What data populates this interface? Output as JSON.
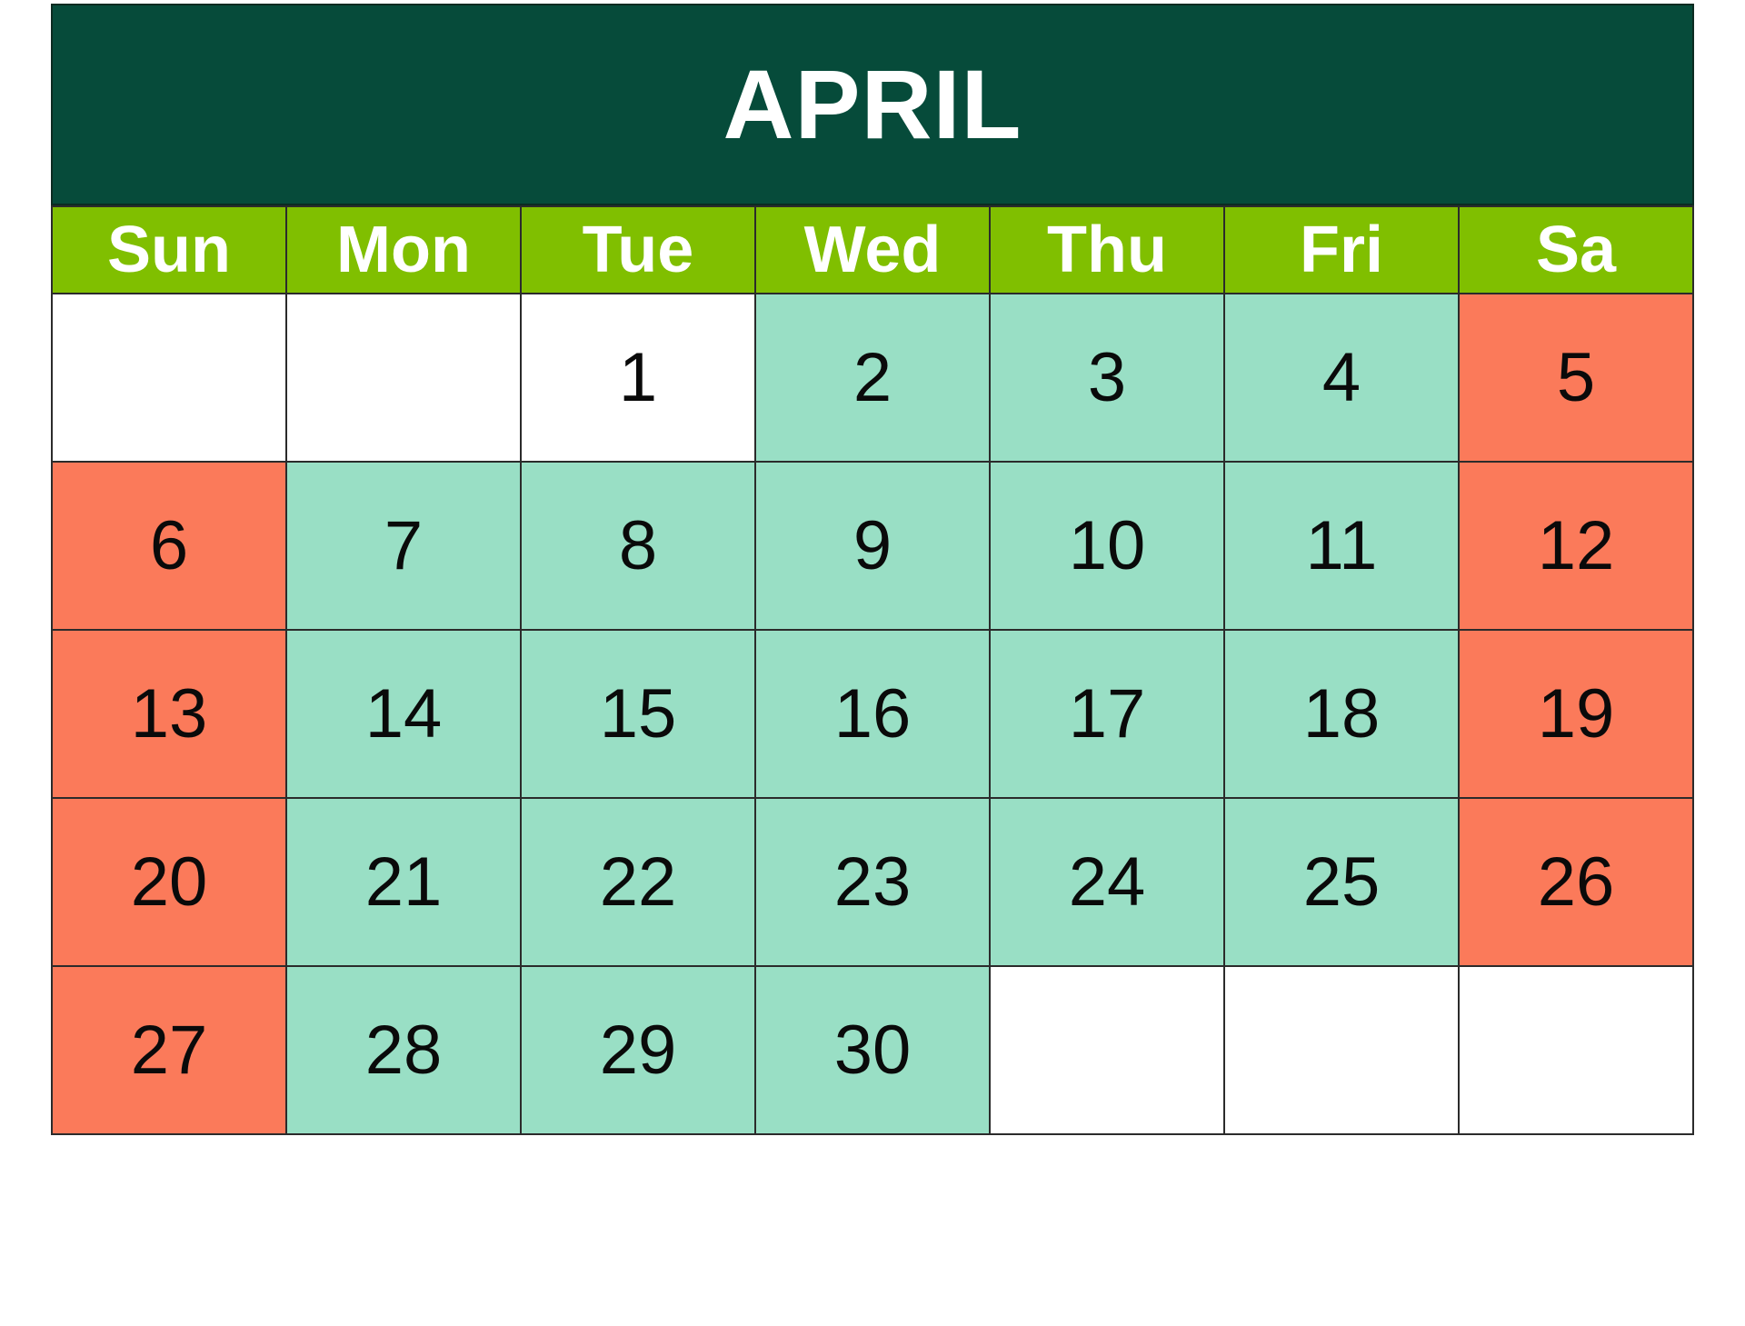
{
  "calendar": {
    "month_title": "APRIL",
    "weekday_headers": [
      {
        "label": "Sun"
      },
      {
        "label": "Mon"
      },
      {
        "label": "Tue"
      },
      {
        "label": "Wed"
      },
      {
        "label": "Thu"
      },
      {
        "label": "Fri"
      },
      {
        "label": "Sa"
      }
    ],
    "weeks": [
      {
        "days": [
          {
            "num": "",
            "fill": "white"
          },
          {
            "num": "",
            "fill": "white"
          },
          {
            "num": "1",
            "fill": "white"
          },
          {
            "num": "2",
            "fill": "mint"
          },
          {
            "num": "3",
            "fill": "mint"
          },
          {
            "num": "4",
            "fill": "mint"
          },
          {
            "num": "5",
            "fill": "coral"
          }
        ]
      },
      {
        "days": [
          {
            "num": "6",
            "fill": "coral"
          },
          {
            "num": "7",
            "fill": "mint"
          },
          {
            "num": "8",
            "fill": "mint"
          },
          {
            "num": "9",
            "fill": "mint"
          },
          {
            "num": "10",
            "fill": "mint"
          },
          {
            "num": "11",
            "fill": "mint"
          },
          {
            "num": "12",
            "fill": "coral"
          }
        ]
      },
      {
        "days": [
          {
            "num": "13",
            "fill": "coral"
          },
          {
            "num": "14",
            "fill": "mint"
          },
          {
            "num": "15",
            "fill": "mint"
          },
          {
            "num": "16",
            "fill": "mint"
          },
          {
            "num": "17",
            "fill": "mint"
          },
          {
            "num": "18",
            "fill": "mint"
          },
          {
            "num": "19",
            "fill": "coral"
          }
        ]
      },
      {
        "days": [
          {
            "num": "20",
            "fill": "coral"
          },
          {
            "num": "21",
            "fill": "mint"
          },
          {
            "num": "22",
            "fill": "mint"
          },
          {
            "num": "23",
            "fill": "mint"
          },
          {
            "num": "24",
            "fill": "mint"
          },
          {
            "num": "25",
            "fill": "mint"
          },
          {
            "num": "26",
            "fill": "coral"
          }
        ]
      },
      {
        "days": [
          {
            "num": "27",
            "fill": "coral"
          },
          {
            "num": "28",
            "fill": "mint"
          },
          {
            "num": "29",
            "fill": "mint"
          },
          {
            "num": "30",
            "fill": "mint"
          },
          {
            "num": "",
            "fill": "white"
          },
          {
            "num": "",
            "fill": "white"
          },
          {
            "num": "",
            "fill": "white"
          }
        ]
      }
    ],
    "colors": {
      "title_bar": "#064B3A",
      "weekday_header": "#80BF00",
      "weekday_fill": "#99DFC5",
      "weekend_fill": "#FB7A5A",
      "empty_fill": "#FFFFFF",
      "grid_line": "#2B2B2B",
      "title_text": "#FFFFFF",
      "day_text": "#0A0A0A"
    }
  }
}
